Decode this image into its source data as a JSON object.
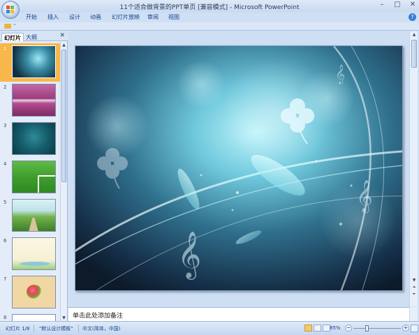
{
  "window": {
    "title": "11个适合做背景的PPT单页 [兼容模式] - Microsoft PowerPoint",
    "controls": [
      "–",
      "□",
      "✕"
    ]
  },
  "ribbon": {
    "tabs": [
      "开始",
      "插入",
      "设计",
      "动画",
      "幻灯片放映",
      "审阅",
      "视图"
    ],
    "help": "?"
  },
  "quick_access": {
    "dropdown": "⁼"
  },
  "panel": {
    "tabs": [
      "幻灯片",
      "大纲"
    ],
    "close": "✕",
    "slide_numbers": [
      "1",
      "2",
      "3",
      "4",
      "5",
      "6",
      "7",
      "8"
    ]
  },
  "notes": {
    "placeholder": "单击此处添加备注"
  },
  "status": {
    "slide_info": "幻灯片 1/8",
    "theme": "\"默认设计模板\"",
    "language": "中文(简体，中国)",
    "zoom": "85%",
    "zoom_minus": "−",
    "zoom_plus": "+"
  }
}
